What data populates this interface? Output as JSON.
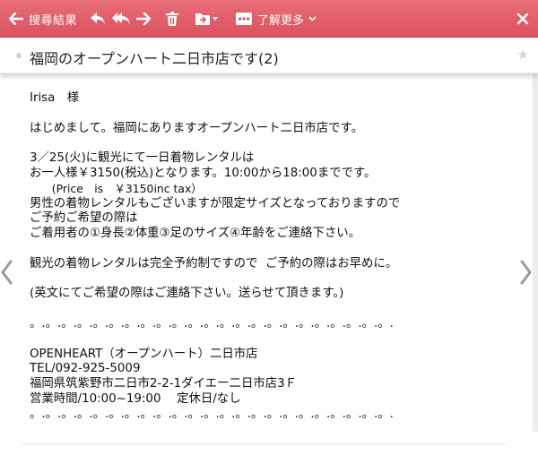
{
  "toolbar": {
    "back_label": "搜尋結果",
    "more_label": "了解更多",
    "background": "#e06170",
    "icons": [
      "arrow-left-icon",
      "reply-icon",
      "reply-all-icon",
      "forward-icon",
      "trash-icon",
      "folder-move-icon",
      "more-dots-icon",
      "chevron-down-icon",
      "close-icon"
    ]
  },
  "subject": {
    "title": "福岡のオープンハート二日市店です(2)",
    "star": "★"
  },
  "message": {
    "lines": [
      "Irisa　様",
      "",
      "はじめまして。福岡にありますオープンハート二日市店です。",
      "",
      "3／25(火)に観光にて一日着物レンタルは",
      "お一人様￥3150(税込)となります。10:00から18:00までです。",
      "　　(Price　is　￥3150inc tax）",
      "男性の着物レンタルもございますが限定サイズとなっておりますので",
      "ご予約ご希望の際は",
      "ご着用者の①身長②体重③足のサイズ④年齢をご連絡下さい。",
      "",
      "観光の着物レンタルは完全予約制ですので  ご予約の際はお早めに。",
      "",
      "(英文にてご希望の際はご連絡下さい。送らせて頂きます。)",
      "",
      "。.。.。.。.。.。.。.。.。.。.。.。.。.。.。.。.。.。.。.。.。.。.。.",
      "",
      "OPENHEART（オープンハート）二日市店",
      "TEL/092-925-5009",
      "福岡県筑紫野市二日市2-2-1ダイエー二日市店3Ｆ",
      "営業時間/10:00~19:00　 定休日/なし",
      "。.。.。.。.。.。.。.。.。.。.。.。.。.。.。.。.。.。.。.。.。.。.。."
    ]
  }
}
